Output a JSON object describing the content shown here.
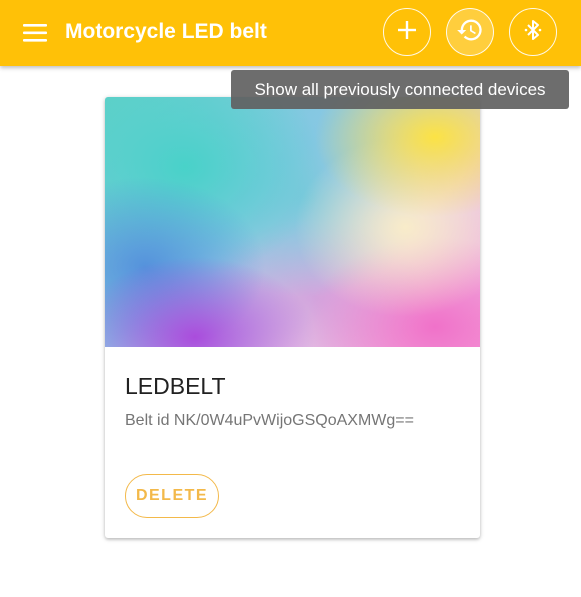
{
  "app_bar": {
    "title": "Motorcycle LED belt",
    "background_color": "#FFC107",
    "menu_icon": "hamburger-menu-icon",
    "actions": [
      {
        "name": "add",
        "icon": "plus-icon"
      },
      {
        "name": "history",
        "icon": "history-icon",
        "active": true
      },
      {
        "name": "bluetooth",
        "icon": "bluetooth-icon"
      }
    ]
  },
  "tooltip": {
    "text": "Show all previously connected devices"
  },
  "device_card": {
    "title": "LEDBELT",
    "subtitle": "Belt id NK/0W4uPvWijoGSQoAXMWg==",
    "delete_label": "DELETE",
    "accent_color": "#F3B94A"
  }
}
